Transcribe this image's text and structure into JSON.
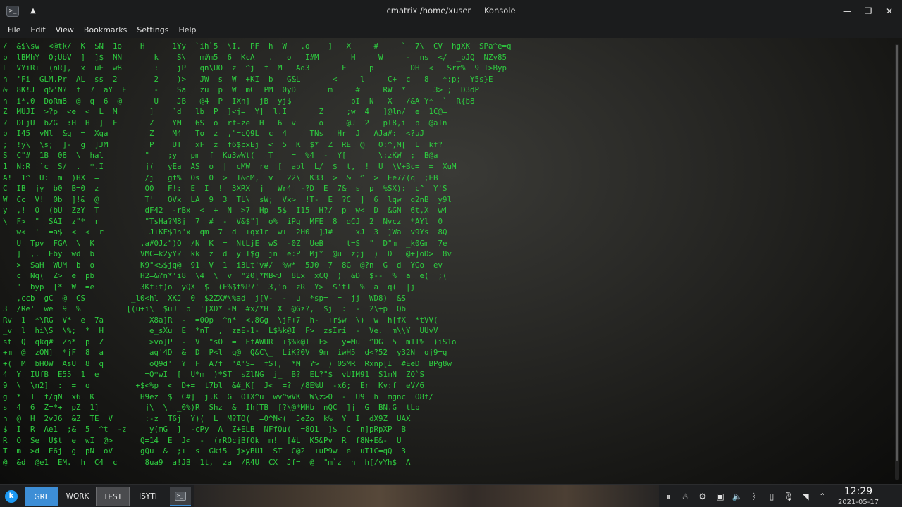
{
  "window": {
    "title": "cmatrix /home/xuser — Konsole",
    "app_icon": "konsole-icon",
    "pin_icon": "▲",
    "minimize_icon": "—",
    "maximize_icon": "❐",
    "close_icon": "✕"
  },
  "menubar": {
    "items": [
      "File",
      "Edit",
      "View",
      "Bookmarks",
      "Settings",
      "Help"
    ]
  },
  "terminal": {
    "program": "cmatrix",
    "text_color": "#2ecc40",
    "highlight_color": "#ffffff",
    "lines": [
      "/  &$\\sw  <@tk/  K  $N  1o    H      1Yy  `ih`5  \\I.  PF  h  W   .o    ]   X     #     `  7\\  CV  hgXK  SPa^e=q",
      "b  lBMhY  O;UbV  ]  ]$  NN       k    S\\   m#m5  6  KcA   .   o   I#M       H     W     -  ns  </  _pJQ  NZy85",
      "L  VYiR+  (nR],  x  uE  w8       :    jP   qn\\UO  z  ^j  f  M   Ad3       F     p        DH  <   Srr%  9 I>Byp",
      "h  'Fi  GLM.Pr  AL  ss  2        2    )>   JW  s  W  +KI  b   G&L       <     l     C+  c   8   *:p;  Y5s}E",
      "&  8K!J  q&'N?  f  7  aY  F      -    Sa   zu  p  W  mC  PM  0yD       m     #     RW  *      3>_;  D3dP",
      "h  i*.0  DoRm8  @  q  6  @       U    JB   @4  P  IXh]  jB  yj$             bI  N   X   /&A Y*  `  R{b8",
      "Z  MUJI  >?p  <e  <  L  M       ]    `d   lb  P  ]<j=  Y]  l.I       Z     ;w  4   ]@ln/  e  1C@=",
      "?  DLjU  bZG  :H  H  ]  F       Z    YM   6S  o  rf-ze  H   6  v     o     @J  2   pl8,i  p  @aIn",
      "p  I45  vNl  &q  =  Xga         Z    M4   To  z  ,\"=cQ9L  c  4     TNs   Hr  J   AJa#:  <?uJ",
      ";  !y\\  \\s;  ]-  g  ]JM         P    UT   xF  z  f6$cxEj  <  5  K  $*  Z  RE  @   O:^,M[  L  kf?",
      "S  C\"#  1B  08  \\  hal         \"    ;y   pm  f  Ku3wWt(   T    =  %4  -  Y[       \\:zKW  ;  B@a",
      "1  N:R  `c  S/  .  *.I         j(   yEa  AS  o  |  cMW  re  [  abl  L/  $  t,  !  U  \\V+Bc=  =  XuM",
      "A!  1^  U:  m  )HX  =          /j   gf%  Os  0  >  I&cM,  v   22\\  K33  >  &  ^  >  Ee7/(q  ;EB",
      "C  IB  jy  b0  B=0  z          O0   F!:  E  I  !  3XRX  j   Wr4  -?D  E  7&  s  p  %SX):  c^  Y'S",
      "W  Cc  V!  0b  ]!&  @          T'   OVx  LA  9  3  TL\\  sW;  Vx>  !T-  E  ?C  ]  6  lqw  q2nB  y9l",
      "y  ,!  O  (bU  ZzY  T          dF42  -rBx  <  +  N  >7  Hp  5$  I15  H?/  p  w<  D  &GN  6t,X  w4",
      "\\  F>  \"  SAI  z\"*  r          \"TsHa?M8j  7  #  -  V&$\"]  o%  iPq  MFE  8  qCJ  2  Nvcz  *AYl  0",
      "   w<  '  =a$  <  <  r          J+KF$Jh\"x  qm  7  d  +qx1r  w+  2H0  ]J#     xJ  3  ]Wa  v9Ys  8Q",
      "   U  Tpv  FGA  \\  K          ,a#0Jz\")Q  /N  K  =  NtLjE  wS  -0Z  UeB     t=S  \"  D\"m  _k0Gm  7e",
      "   ]  ,.  Eby  wd  b          VMC=k2yY?  kk  z  d  y_T$g  jn  e:P  Mj*  @u  z;j  )  D   @+]oD>  8v",
      "   >  SaH  WUM  b  o          K9\"<$$jq@  91  V  1  i3Lt'v#/  %w*  5J0  7  8G  @?n  G  d  YGo  ev",
      "   c  Nq(  Z>  e  pb          H2=&?n*'i8  \\4  \\  v  \"20[*MB<J  8Lx  xCQ  )  &D  $--  %  a  e(  ;(",
      "   \"  byp  [*  W  =e          3Kf:f)o  yQX  $  (F%$f%P7'  3,'o  zR  Y>  $'tI  %  a  q(  |j",
      "   ,ccb  gC  @  CS          _l0<hl  XKJ  0  $2ZX#\\%ad  j[V-  -  u  *sp=  =  jj  WD8)  &S",
      "3  /Re'  we  9  %          [(u+i\\  $uJ  b  ']XD*_-M  #x/*H  X  @Gz?,  $j  :  -  2\\+p  Qb",
      "Rv  1  *\\RG  V*  e  7a          X8a]R  -  =0Op  ^n*  <.8Gg  \\jF+7  h-  +r$w  \\)  w  h[fX  *tVV(",
      "_v  l  hi\\S  \\%;  *  H          e_sXu  E  *nT  ,  zaE-1-  L$%k@I  F>  zsIri  -  Ve.  m\\\\Y  UUvV",
      "st  Q  qkq#  Zh*  p  Z          >vo]P  -  V  \"sO  =  EfAWUR  +$%k@I  F>  _y=Mu  ^DG  5  m1T%  )iS1o",
      "+m  @  zON]  *jF  8  a          ag'4D  &  D  P<l  q@  Q&C\\_  LiK?0V  9m  iwH5  d<?52  y32N  oj9=g",
      "+(  M  bHOW  AsU  8  q          oQ9d'  Y  F  A7f  'A'S=  fST,  *M  ?>  )_0SMR  Rxnp[I  #EeD  BPg8w",
      "4  Y  IUfB  E55  1  e          =Q*wI  [  U*m  )*ST  sZlNG  j_  B?  EL?\"$  vUIM91  S1mN  ZQ`S",
      "9  \\  \\n2]  :  =  o          +$<%p  <  D+=  t7bl  &#_K[  J<  =?  /8E%U  -x6;  Er  Ky:f  eV/6",
      "g  *  I  f/qN  x6  K          H9ez  $  C#]  j.K  G  O1X^u  wv^wVK  W\\z>0  -  U9  h  mgnc  O8f/",
      "s  4  6  Z=*+  pZ  1]          j\\  \\  _0%)R  Shz  &  Ih[TB  [?\\@*MHb  nQC  ]j  G  BN.G  tLb",
      "h  @  H  2vJ6  &Z  TE  V       :-z  T6j  Y)(  L  M?TO(  =0^N<(  JeZo  k%  Y  I  dX9Z  UAX",
      "$  I  R  Ae1  ;&  5  ^t  -z     y(mG  ]  -cPy  A  Z+ELB  NFfQu(  =8Q1  ]$  C  n]pRpXP  B",
      "R  O  Se  U$t  e  wI  @>      Q=14  E  J<  -  (rROcjBfOk  m!  [#L  K5&Pv  R  f8N+E&-  U",
      "T  m  >d  E6j  g  pN  oV      gQu  &  ;+  s  Gki5  j>yBU1  ST  C@2  +uP9w  e  uT1C=qQ  3",
      "@  &d  @e1  EM.  h  C4  c      8ua9  a!JB  1t,  za  /R4U  CX  Jf=  @  \"m`z  h  h[/vYh$  A"
    ]
  },
  "taskbar": {
    "launcher_icon": "kde-launcher-icon",
    "desktops": [
      {
        "label": "GRL"
      },
      {
        "label": "WORK"
      },
      {
        "label": "TEST"
      },
      {
        "label": "ISYTI"
      }
    ],
    "task": "konsole-task",
    "tray": [
      "pause-icon",
      "steam-icon",
      "settings-icon",
      "clipboard-icon",
      "volume-icon",
      "bluetooth-icon",
      "battery-icon",
      "microphone-icon",
      "network-icon",
      "chevron-up-icon"
    ],
    "clock_time": "12:29",
    "clock_date": "2021-05-17"
  }
}
